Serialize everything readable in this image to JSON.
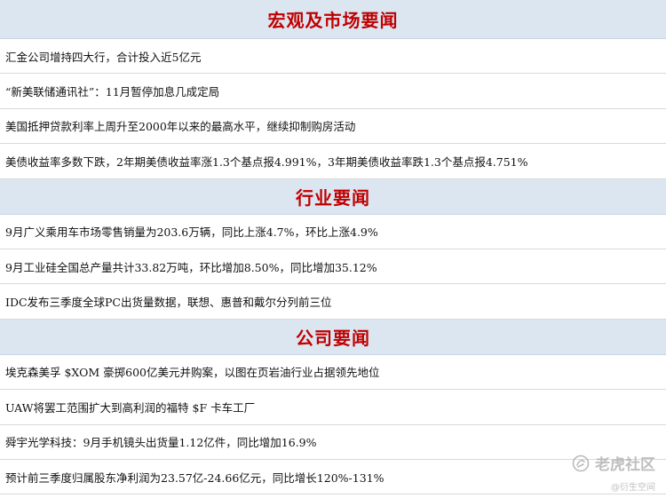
{
  "sections": [
    {
      "title": "宏观及市场要闻",
      "items": [
        "汇金公司增持四大行，合计投入近5亿元",
        "“新美联储通讯社”：11月暂停加息几成定局",
        "美国抵押贷款利率上周升至2000年以来的最高水平，继续抑制购房活动",
        "美债收益率多数下跌，2年期美债收益率涨1.3个基点报4.991%，3年期美债收益率跌1.3个基点报4.751%"
      ]
    },
    {
      "title": "行业要闻",
      "items": [
        "9月广义乘用车市场零售销量为203.6万辆，同比上涨4.7%，环比上涨4.9%",
        "9月工业硅全国总产量共计33.82万吨，环比增加8.50%，同比增加35.12%",
        "IDC发布三季度全球PC出货量数据，联想、惠普和戴尔分列前三位"
      ]
    },
    {
      "title": "公司要闻",
      "items": [
        "埃克森美孚 $XOM 豪掷600亿美元并购案，以图在页岩油行业占据领先地位",
        "UAW将罢工范围扩大到高利润的福特 $F 卡车工厂",
        "舜宇光学科技：9月手机镜头出货量1.12亿件，同比增加16.9%",
        "预计前三季度归属股东净利润为23.57亿-24.66亿元，同比增长120%-131%"
      ]
    }
  ],
  "watermark": {
    "brand": "老虎社区",
    "handle": "@衍生空间",
    "icon": "tiger-community-logo-icon"
  },
  "colors": {
    "header_bg": "#dce6f1",
    "header_text": "#c00000",
    "row_divider": "#d9d9d9"
  }
}
